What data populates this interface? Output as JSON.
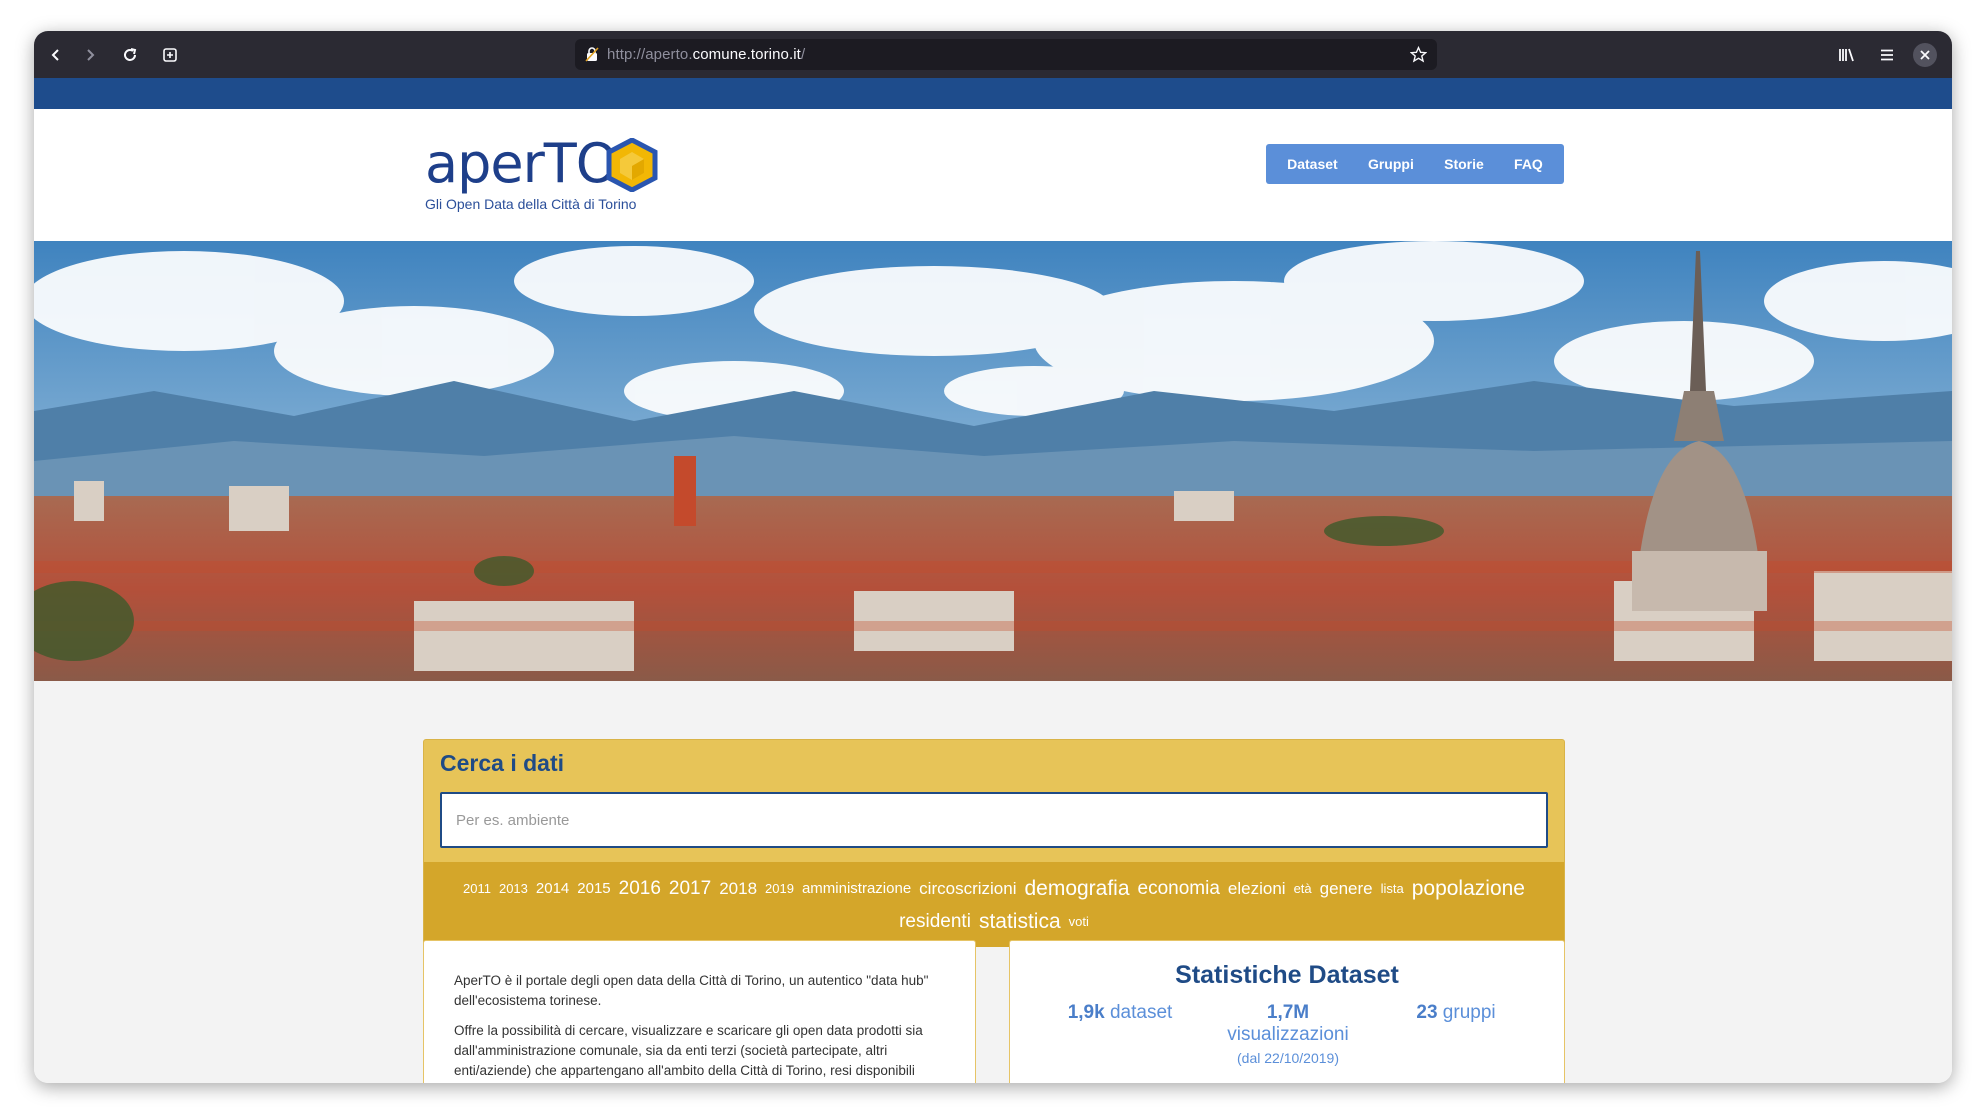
{
  "browser": {
    "url_prefix": "http://aperto.",
    "url_domain": "comune.torino.it",
    "url_suffix": "/"
  },
  "header": {
    "logo_text": "aperTO",
    "logo_subtitle": "Gli Open Data della Città di Torino",
    "nav": [
      "Dataset",
      "Gruppi",
      "Storie",
      "FAQ"
    ]
  },
  "search": {
    "title": "Cerca i dati",
    "placeholder": "Per es. ambiente",
    "tags": [
      {
        "label": "2011",
        "size": 1
      },
      {
        "label": "2013",
        "size": 1
      },
      {
        "label": "2014",
        "size": 2
      },
      {
        "label": "2015",
        "size": 2
      },
      {
        "label": "2016",
        "size": 4
      },
      {
        "label": "2017",
        "size": 4
      },
      {
        "label": "2018",
        "size": 3
      },
      {
        "label": "2019",
        "size": 1
      },
      {
        "label": "amministrazione",
        "size": 2
      },
      {
        "label": "circoscrizioni",
        "size": 3
      },
      {
        "label": "demografia",
        "size": 5
      },
      {
        "label": "economia",
        "size": 4
      },
      {
        "label": "elezioni",
        "size": 3
      },
      {
        "label": "età",
        "size": 1
      },
      {
        "label": "genere",
        "size": 3
      },
      {
        "label": "lista",
        "size": 1
      },
      {
        "label": "popolazione",
        "size": 5
      },
      {
        "label": "residenti",
        "size": 4
      },
      {
        "label": "statistica",
        "size": 5
      },
      {
        "label": "voti",
        "size": 1
      }
    ]
  },
  "about": {
    "p1": "AperTO è il portale degli open data della Città di Torino, un autentico \"data hub\" dell'ecosistema torinese.",
    "p2": "Offre la possibilità di cercare, visualizzare e scaricare gli open data prodotti sia dall'amministrazione comunale, sia da enti terzi (società partecipate, altri enti/aziende) che appartengano all'ambito della Città di Torino, resi disponibili"
  },
  "stats": {
    "title": "Statistiche Dataset",
    "datasets_value": "1,9k",
    "datasets_label": "dataset",
    "views_value": "1,7M",
    "views_label": "visualizzazioni",
    "views_date": "(dal 22/10/2019)",
    "groups_value": "23",
    "groups_label": "gruppi"
  },
  "colors": {
    "topstrip": "#1e4c8c",
    "nav": "#5b8fd9",
    "search_panel": "#e7c458",
    "tag_band": "#d4a62a",
    "title_blue": "#1f4b86"
  }
}
